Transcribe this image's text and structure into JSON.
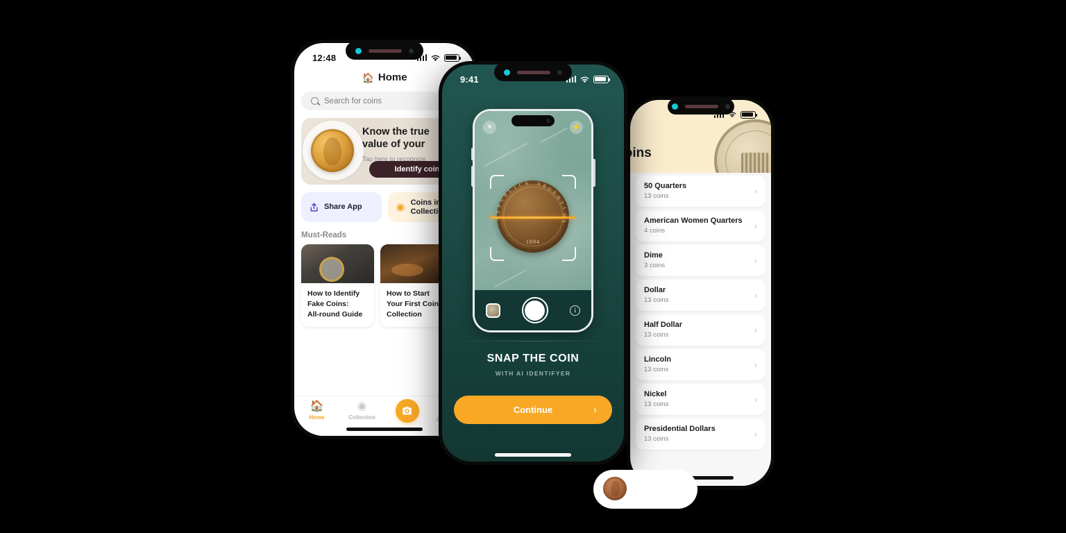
{
  "colors": {
    "accent_orange": "#f9a825",
    "deep_teal": "#133733",
    "dark_maroon": "#3b2228",
    "cream": "#fbeccd",
    "page_background": "#000000"
  },
  "left_phone": {
    "status": {
      "time": "12:48"
    },
    "header": {
      "title": "Home",
      "icon": "home-icon"
    },
    "search": {
      "placeholder": "Search for coins",
      "icon": "search-icon"
    },
    "hero": {
      "heading_line1": "Know the true",
      "heading_line2": "value of your",
      "subtitle": "Tap here to recognize",
      "button_label": "Identify coin"
    },
    "quick_actions": [
      {
        "label": "Share App",
        "icon": "share-icon"
      },
      {
        "label_line1": "Coins in",
        "label_line2": "Collection",
        "icon": "coin-icon"
      }
    ],
    "section_title": "Must-Reads",
    "articles": [
      {
        "title_line1": "How to Identify",
        "title_line2": "Fake Coins:",
        "title_line3": "All-round Guide"
      },
      {
        "title_line1": "How to Start",
        "title_line2": "Your First Coin",
        "title_line3": "Collection"
      }
    ],
    "tabs": [
      {
        "label": "Home",
        "icon": "home-icon",
        "active": true
      },
      {
        "label": "Collection",
        "icon": "coin-icon",
        "active": false
      },
      {
        "label": "",
        "icon": "camera-icon",
        "active": false
      },
      {
        "label": "Coin Expert",
        "icon": "ai-icon",
        "active": false
      }
    ]
  },
  "center_phone": {
    "status": {
      "time": "9:41"
    },
    "camera": {
      "close_icon": "close-icon",
      "flash_icon": "flash-icon",
      "coin_text_top": "REPUBLICA ARGENTINA",
      "coin_year": "1894",
      "thumbnail_icon": "gallery-thumbnail",
      "shutter_icon": "shutter-button",
      "info_icon": "info-icon"
    },
    "heading": "SNAP THE COIN",
    "subheading": "WITH AI IDENTIFYER",
    "cta": {
      "label": "Continue",
      "chevron": "›"
    }
  },
  "right_phone": {
    "header": {
      "title": "Coins"
    },
    "items": [
      {
        "name": "50 Quarters",
        "count": "13 coins"
      },
      {
        "name": "American Women Quarters",
        "count": "4 coins"
      },
      {
        "name": "Dime",
        "count": "3 coins"
      },
      {
        "name": "Dollar",
        "count": "13 coins"
      },
      {
        "name": "Half Dollar",
        "count": "13 coins"
      },
      {
        "name": "Lincoln",
        "count": "13 coins"
      },
      {
        "name": "Nickel",
        "count": "13 coins"
      },
      {
        "name": "Presidential Dollars",
        "count": "13 coins"
      }
    ],
    "chevron": "›"
  }
}
